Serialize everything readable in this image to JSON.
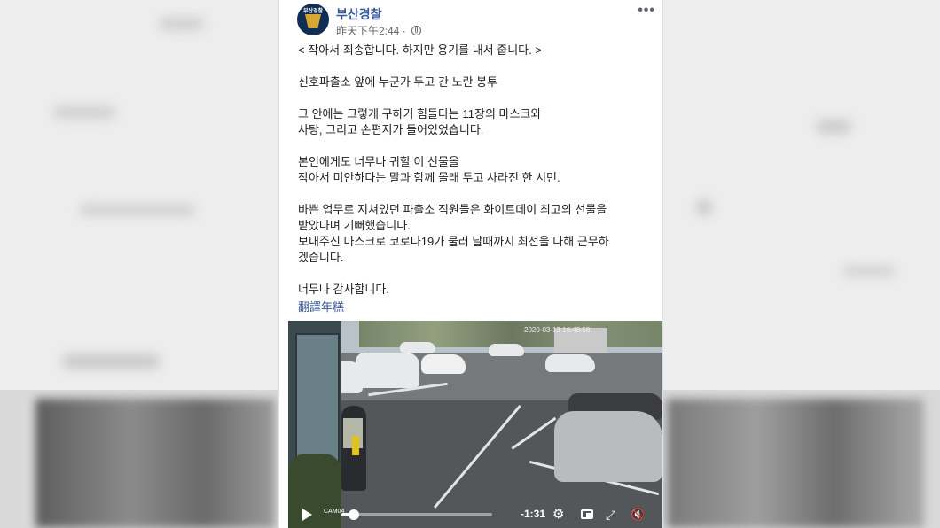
{
  "post": {
    "page_name": "부산경찰",
    "avatar_text": "부산경찰",
    "timestamp": "昨天下午2:44 ·",
    "more": "•••",
    "lines": [
      "< 작아서 죄송합니다. 하지만 용기를 내서 줍니다. >",
      "",
      "신호파출소 앞에 누군가 두고 간 노란 봉투",
      "",
      "그 안에는 그렇게 구하기 힘들다는 11장의 마스크와",
      "사탕, 그리고 손편지가 들어있었습니다.",
      "",
      "본인에게도 너무나 귀할 이 선물을",
      "작아서 미안하다는 말과 함께 몰래 두고 사라진 한 시민.",
      "",
      "바쁜 업무로 지쳐있던 파출소 직원들은 화이트데이 최고의 선물을",
      "받았다며 기뻐했습니다.",
      "보내주신 마스크로 코로나19가 물러 날때까지 최선을 다해 근무하",
      "겠습니다.",
      "",
      "너무나 감사합니다."
    ],
    "translate_link": "翻譯年糕"
  },
  "video": {
    "cam_timestamp": "2020-03-13 16:48:58",
    "cam_label": "CAM04",
    "time_remaining": "-1:31",
    "progress": 0.08,
    "controls": {
      "play": "play-icon",
      "settings": "gear-icon",
      "pip": "picture-in-picture-icon",
      "fullscreen": "fullscreen-icon",
      "mute": "muted-speaker-icon"
    }
  },
  "colors": {
    "link": "#385898",
    "text": "#1c1e21",
    "meta": "#606770"
  }
}
